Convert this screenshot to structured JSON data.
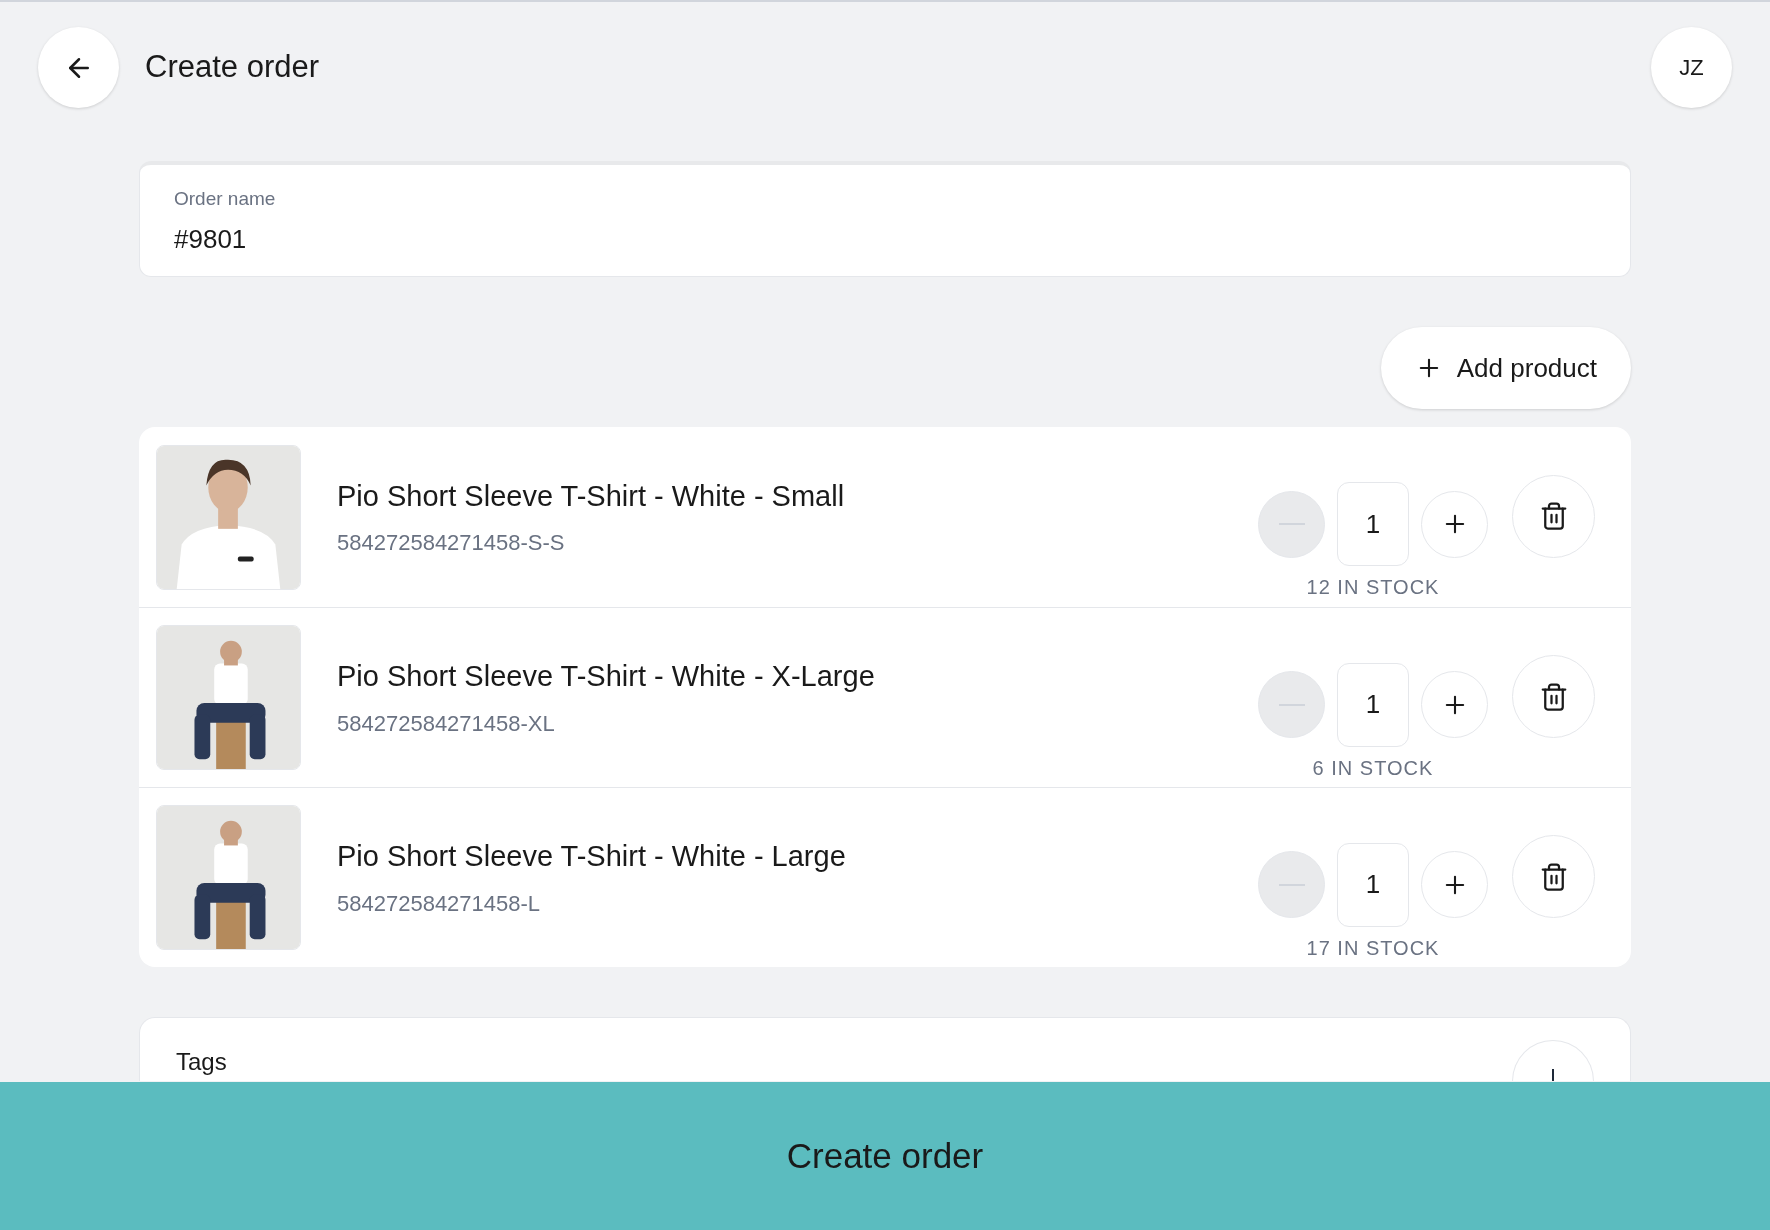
{
  "header": {
    "title": "Create order",
    "avatar": "JZ"
  },
  "order_name": {
    "label": "Order name",
    "value": "#9801"
  },
  "add_product": {
    "label": "Add product"
  },
  "products": [
    {
      "name": "Pio Short Sleeve T-Shirt - White - Small",
      "sku": "584272584271458-S-S",
      "quantity": "1",
      "stock": "12 IN STOCK",
      "decrease_disabled": true
    },
    {
      "name": "Pio Short Sleeve T-Shirt - White - X-Large",
      "sku": "584272584271458-XL",
      "quantity": "1",
      "stock": "6 IN STOCK",
      "decrease_disabled": true
    },
    {
      "name": "Pio Short Sleeve T-Shirt - White - Large",
      "sku": "584272584271458-L",
      "quantity": "1",
      "stock": "17 IN STOCK",
      "decrease_disabled": true
    }
  ],
  "tags": {
    "label": "Tags"
  },
  "footer": {
    "button": "Create order"
  }
}
